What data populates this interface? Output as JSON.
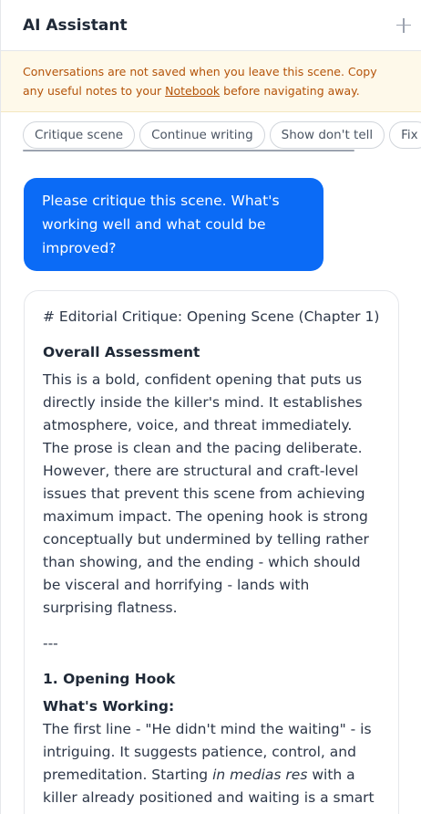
{
  "header": {
    "title": "AI Assistant",
    "new_icon": "plus-icon"
  },
  "notice": {
    "text_before": "Conversations are not saved when you leave this scene. Copy any useful notes to your ",
    "link": "Notebook",
    "text_after": " before navigating away."
  },
  "chips": [
    {
      "label": "Critique scene"
    },
    {
      "label": "Continue writing"
    },
    {
      "label": "Show don't tell"
    },
    {
      "label": "Fix"
    }
  ],
  "user_message": "Please critique this scene. What's working well and what could be improved?",
  "ai_message": {
    "title_line": "# Editorial Critique: Opening Scene (Chapter 1)",
    "section_heading": "Overall Assessment",
    "assessment": "This is a bold, confident opening that puts us directly inside the killer's mind. It establishes atmosphere, voice, and threat immediately. The prose is clean and the pacing deliberate. However, there are structural and craft-level issues that prevent this scene from achieving maximum impact. The opening hook is strong conceptually but undermined by telling rather than showing, and the ending - which should be visceral and horrifying - lands with surprising flatness.",
    "separator": "---",
    "subsection_heading": "1. Opening Hook",
    "working_heading": "What's Working:",
    "working_before": "The first line - \"He didn't mind the waiting\" - is intriguing. It suggests patience, control, and premeditation. Starting ",
    "working_italic": "in medias res",
    "working_after": " with a killer already positioned and waiting is a smart structural choice."
  },
  "colors": {
    "accent": "#0b6bf6",
    "notice_bg": "#fef9ea",
    "notice_text": "#b45309"
  }
}
